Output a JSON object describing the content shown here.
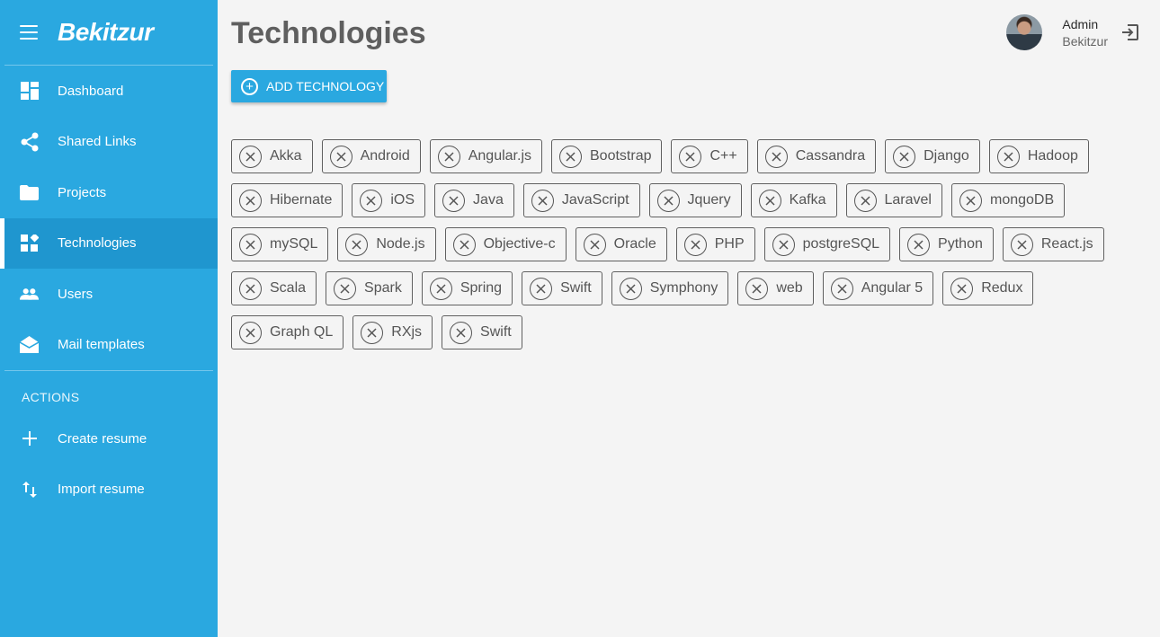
{
  "app": {
    "logo": "Bekitzur"
  },
  "sidebar": {
    "items": [
      {
        "label": "Dashboard",
        "icon": "dashboard-icon"
      },
      {
        "label": "Shared Links",
        "icon": "share-icon"
      },
      {
        "label": "Projects",
        "icon": "folder-icon"
      },
      {
        "label": "Technologies",
        "icon": "widgets-icon",
        "active": true
      },
      {
        "label": "Users",
        "icon": "people-icon"
      },
      {
        "label": "Mail templates",
        "icon": "mail-icon"
      }
    ],
    "actions_title": "ACTIONS",
    "actions": [
      {
        "label": "Create resume",
        "icon": "plus-icon"
      },
      {
        "label": "Import resume",
        "icon": "import-icon"
      }
    ]
  },
  "page": {
    "title": "Technologies",
    "add_button": "ADD TECHNOLOGY"
  },
  "user": {
    "name": "Admin",
    "org": "Bekitzur"
  },
  "technologies": [
    "Akka",
    "Android",
    "Angular.js",
    "Bootstrap",
    "C++",
    "Cassandra",
    "Django",
    "Hadoop",
    "Hibernate",
    "iOS",
    "Java",
    "JavaScript",
    "Jquery",
    "Kafka",
    "Laravel",
    "mongoDB",
    "mySQL",
    "Node.js",
    "Objective-c",
    "Oracle",
    "PHP",
    "postgreSQL",
    "Python",
    "React.js",
    "Scala",
    "Spark",
    "Spring",
    "Swift",
    "Symphony",
    "web",
    "Angular 5",
    "Redux",
    "Graph QL",
    "RXjs",
    "Swift"
  ],
  "colors": {
    "sidebar": "#2aa8e0",
    "sidebar_active": "#1f96cf",
    "background": "#f4f4f4"
  }
}
